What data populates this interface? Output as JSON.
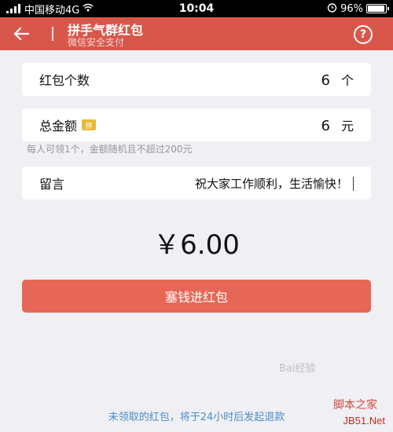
{
  "status_bar": {
    "carrier": "中国移动4G",
    "time": "10:04",
    "battery": "96%",
    "battery_level": 0.96
  },
  "nav": {
    "title": "拼手气群红包",
    "subtitle": "微信安全支付",
    "help_label": "?"
  },
  "count_row": {
    "label": "红包个数",
    "value": "6",
    "unit": "个"
  },
  "total_row": {
    "label": "总金额",
    "badge": "拼",
    "value": "6",
    "unit": "元"
  },
  "hint": "每人可领1个，金额随机且不超过200元",
  "message_row": {
    "label": "留言",
    "value": "祝大家工作顺利，生活愉快！"
  },
  "amount": "￥6.00",
  "submit_label": "塞钱进红包",
  "footer_note": "未领取的红包，将于24小时后发起退款",
  "watermark": {
    "line1": "脚本之家",
    "line2": "JB51.Net",
    "baidu": "Bai经验"
  },
  "colors": {
    "nav_bg": "#d8574b",
    "button_bg": "#e76756",
    "footer_text": "#4a8ec8"
  }
}
